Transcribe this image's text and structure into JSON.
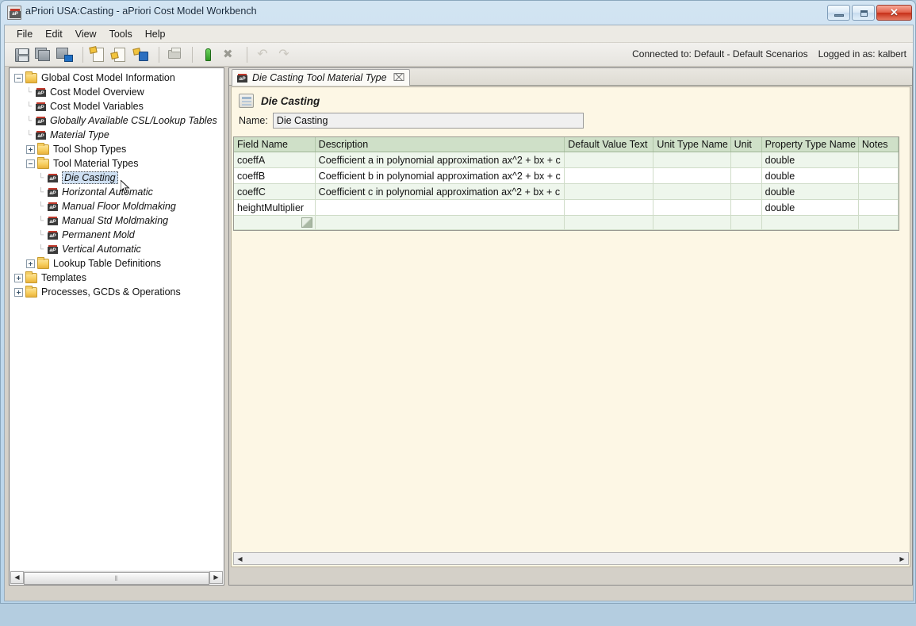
{
  "window": {
    "title": "aPriori USA:Casting - aPriori Cost Model Workbench",
    "app_icon": "apriori-logo-icon",
    "buttons": {
      "minimize": "minimize-icon",
      "maximize": "maximize-icon",
      "close_glyph": "✕"
    }
  },
  "menubar": {
    "items": [
      {
        "label": "File"
      },
      {
        "label": "Edit"
      },
      {
        "label": "View"
      },
      {
        "label": "Tools"
      },
      {
        "label": "Help"
      }
    ]
  },
  "toolbar": {
    "icons": [
      {
        "name": "save-icon",
        "title": "Save"
      },
      {
        "name": "save-all-icon",
        "title": "Save All"
      },
      {
        "name": "save-as-icon",
        "title": "Save As"
      },
      {
        "name": "new-document-icon",
        "title": "New"
      },
      {
        "name": "open-document-icon",
        "title": "Open"
      },
      {
        "name": "publish-icon",
        "title": "Publish"
      },
      {
        "name": "print-icon",
        "title": "Print"
      },
      {
        "name": "deploy-icon",
        "title": "Deploy"
      },
      {
        "name": "tools-icon",
        "title": "Tools"
      },
      {
        "name": "undo-icon",
        "title": "Undo"
      },
      {
        "name": "redo-icon",
        "title": "Redo"
      }
    ],
    "connected_to": "Connected to: Default - Default Scenarios",
    "logged_in_as": "Logged in as: kalbert"
  },
  "tree": {
    "items": [
      {
        "label": "Global Cost Model Information",
        "depth": 0,
        "icon": "folder",
        "expander": "minus",
        "italic": false,
        "selected": false
      },
      {
        "label": "Cost Model Overview",
        "depth": 1,
        "icon": "ap",
        "expander": "none",
        "italic": false,
        "selected": false
      },
      {
        "label": "Cost Model Variables",
        "depth": 1,
        "icon": "ap",
        "expander": "none",
        "italic": false,
        "selected": false
      },
      {
        "label": "Globally Available CSL/Lookup Tables",
        "depth": 1,
        "icon": "ap",
        "expander": "none",
        "italic": true,
        "selected": false
      },
      {
        "label": "Material Type",
        "depth": 1,
        "icon": "ap",
        "expander": "none",
        "italic": true,
        "selected": false
      },
      {
        "label": "Tool Shop Types",
        "depth": 1,
        "icon": "folder",
        "expander": "plus",
        "italic": false,
        "selected": false
      },
      {
        "label": "Tool Material Types",
        "depth": 1,
        "icon": "folder",
        "expander": "minus",
        "italic": false,
        "selected": false
      },
      {
        "label": "Die Casting",
        "depth": 2,
        "icon": "ap",
        "expander": "none",
        "italic": true,
        "selected": true
      },
      {
        "label": "Horizontal Automatic",
        "depth": 2,
        "icon": "ap",
        "expander": "none",
        "italic": true,
        "selected": false
      },
      {
        "label": "Manual Floor Moldmaking",
        "depth": 2,
        "icon": "ap",
        "expander": "none",
        "italic": true,
        "selected": false
      },
      {
        "label": "Manual Std Moldmaking",
        "depth": 2,
        "icon": "ap",
        "expander": "none",
        "italic": true,
        "selected": false
      },
      {
        "label": "Permanent Mold",
        "depth": 2,
        "icon": "ap",
        "expander": "none",
        "italic": true,
        "selected": false
      },
      {
        "label": "Vertical Automatic",
        "depth": 2,
        "icon": "ap",
        "expander": "none",
        "italic": true,
        "selected": false
      },
      {
        "label": "Lookup Table Definitions",
        "depth": 1,
        "icon": "folder",
        "expander": "plus",
        "italic": false,
        "selected": false
      },
      {
        "label": "Templates",
        "depth": 0,
        "icon": "folder",
        "expander": "plus",
        "italic": false,
        "selected": false
      },
      {
        "label": "Processes, GCDs & Operations",
        "depth": 0,
        "icon": "folder",
        "expander": "plus",
        "italic": false,
        "selected": false
      }
    ],
    "scrollbar": {
      "left_arrow": "◀",
      "right_arrow": "▶",
      "thumb_grip": "‖"
    }
  },
  "editor": {
    "tab": {
      "label": "Die Casting Tool Material Type",
      "icon": "ap-icon",
      "close_glyph": "⌧"
    },
    "header": {
      "icon": "form-icon",
      "title": "Die Casting"
    },
    "name_field": {
      "label": "Name:",
      "value": "Die Casting",
      "placeholder": ""
    },
    "table": {
      "columns": [
        "Field Name",
        "Description",
        "Default Value Text",
        "Unit Type Name",
        "Unit",
        "Property Type Name",
        "Notes"
      ],
      "rows": [
        {
          "field_name": "coeffA",
          "description": "Coefficient a in polynomial approximation ax^2 + bx + c",
          "default_value_text": "",
          "unit_type_name": "",
          "unit": "",
          "property_type_name": "double",
          "notes": ""
        },
        {
          "field_name": "coeffB",
          "description": "Coefficient b in polynomial approximation ax^2 + bx + c",
          "default_value_text": "",
          "unit_type_name": "",
          "unit": "",
          "property_type_name": "double",
          "notes": ""
        },
        {
          "field_name": "coeffC",
          "description": "Coefficient c in polynomial approximation ax^2 + bx + c",
          "default_value_text": "",
          "unit_type_name": "",
          "unit": "",
          "property_type_name": "double",
          "notes": ""
        },
        {
          "field_name": "heightMultiplier",
          "description": "",
          "default_value_text": "",
          "unit_type_name": "",
          "unit": "",
          "property_type_name": "double",
          "notes": ""
        }
      ],
      "new_row_marker": "new-row-icon"
    },
    "scrollbar": {
      "left_arrow": "◀",
      "right_arrow": "▶"
    }
  },
  "colors": {
    "title_bar": "#c3dbee",
    "form_background": "#fdf7e5",
    "table_header": "#cfe0c8",
    "row_even": "#eef6ec",
    "row_odd": "#ffffff",
    "selection": "#cfe0f2",
    "folder": "#f7ce5e",
    "accent_red": "#c0392b"
  }
}
